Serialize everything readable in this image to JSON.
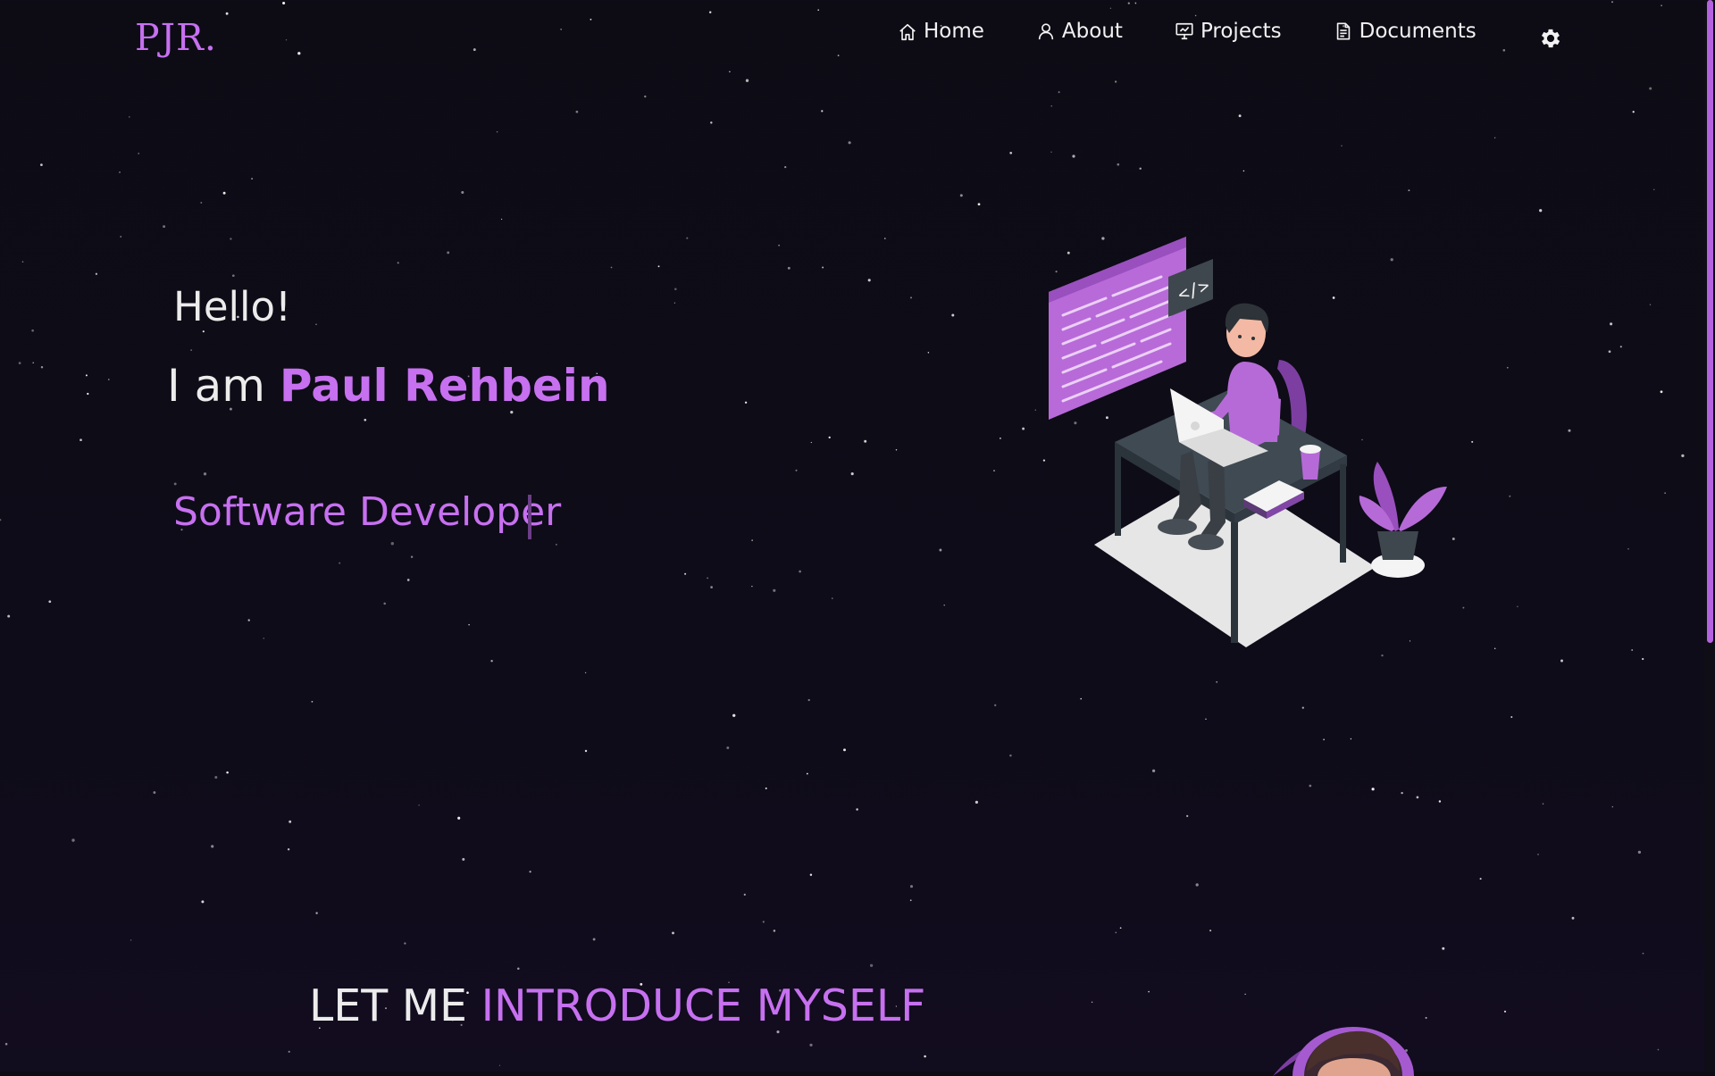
{
  "nav": {
    "logo": "PJR.",
    "links": [
      {
        "label": "Home",
        "icon": "home-icon"
      },
      {
        "label": "About",
        "icon": "user-icon"
      },
      {
        "label": "Projects",
        "icon": "presentation-icon"
      },
      {
        "label": "Documents",
        "icon": "document-icon"
      }
    ],
    "settings_icon": "gear-icon"
  },
  "hero": {
    "greeting": "Hello!",
    "intro_prefix": "I am",
    "name": "Paul Rehbein",
    "role": "Software Developer"
  },
  "about": {
    "heading_prefix": "LET ME",
    "heading_highlight": "INTRODUCE MYSELF"
  },
  "illustration": {
    "code_tag": "</>"
  },
  "colors": {
    "accent": "#c770f0",
    "background": "#0d0c15",
    "text": "#ececec"
  }
}
